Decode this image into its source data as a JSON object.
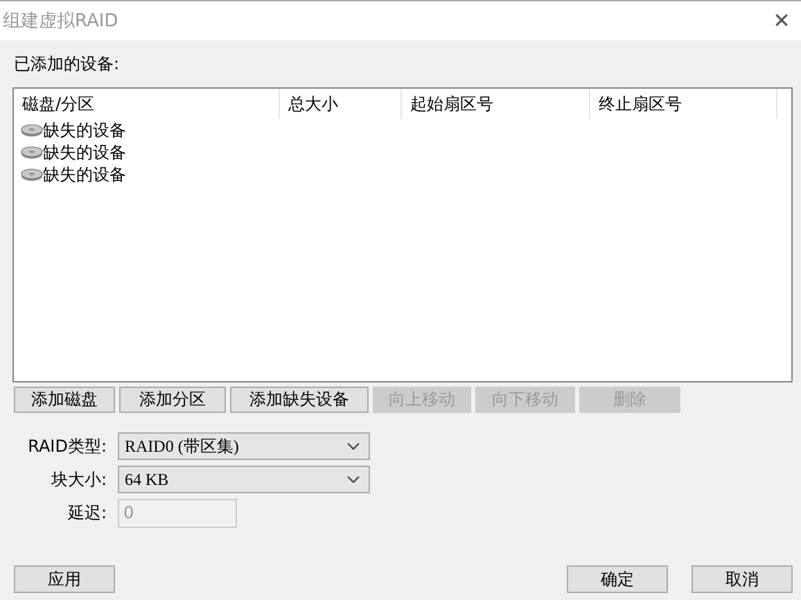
{
  "window": {
    "title": "组建虚拟RAID",
    "close": "✕"
  },
  "devices_label": "已添加的设备:",
  "table": {
    "columns": [
      "磁盘/分区",
      "总大小",
      "起始扇区号",
      "终止扇区号"
    ],
    "rows": [
      {
        "name": "缺失的设备"
      },
      {
        "name": "缺失的设备"
      },
      {
        "name": "缺失的设备"
      }
    ]
  },
  "list_buttons": [
    {
      "label": "添加磁盘",
      "disabled": false
    },
    {
      "label": "添加分区",
      "disabled": false
    },
    {
      "label": "添加缺失设备",
      "disabled": false
    },
    {
      "label": "向上移动",
      "disabled": true
    },
    {
      "label": "向下移动",
      "disabled": true
    },
    {
      "label": "删除",
      "disabled": true
    }
  ],
  "fields": [
    {
      "kind": "select",
      "label": "RAID类型:",
      "value": "RAID0 (带区集)",
      "disabled": false
    },
    {
      "kind": "select",
      "label": "块大小:",
      "value": "64 KB",
      "disabled": false
    },
    {
      "kind": "input",
      "label": "延迟:",
      "value": "0",
      "disabled": true
    }
  ],
  "footer": {
    "apply": "应用",
    "ok": "确定",
    "cancel": "取消"
  }
}
